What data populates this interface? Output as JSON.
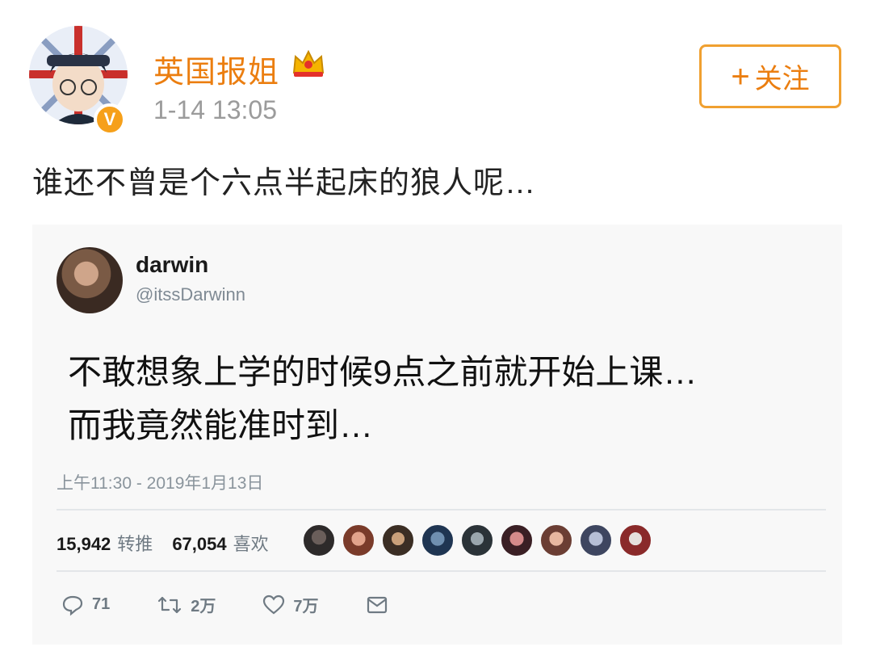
{
  "weibo": {
    "username": "英国报姐",
    "timestamp": "1-14 13:05",
    "follow_label": "关注",
    "verified_badge": "V",
    "post_text": "谁还不曾是个六点半起床的狼人呢…",
    "accent_color": "#eb7e10"
  },
  "tweet": {
    "name": "darwin",
    "handle": "@itssDarwinn",
    "text_line1": "不敢想象上学的时候9点之前就开始上课…",
    "text_line2": "而我竟然能准时到…",
    "date": "上午11:30 - 2019年1月13日",
    "retweets_count": "15,942",
    "retweets_label": "转推",
    "likes_count": "67,054",
    "likes_label": "喜欢",
    "actions": {
      "reply_count": "71",
      "retweet_count": "2万",
      "like_count": "7万"
    },
    "icons": [
      "reply-icon",
      "retweet-icon",
      "heart-icon",
      "mail-icon"
    ]
  }
}
